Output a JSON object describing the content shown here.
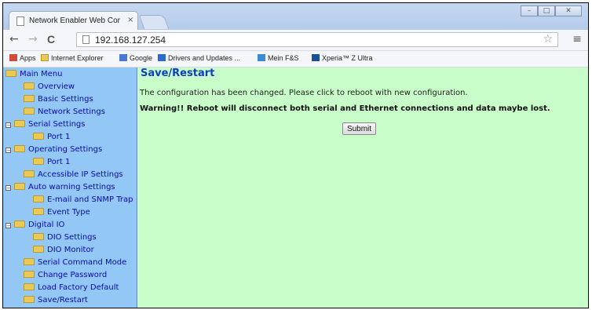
{
  "browser": {
    "tab_title": "Network Enabler Web Cor",
    "tab_close": "×",
    "url": "192.168.127.254",
    "nav": {
      "back": "←",
      "forward": "→",
      "reload": "C"
    },
    "window_buttons": {
      "minimize": "–",
      "maximize": "□",
      "close": "✕"
    },
    "star": "☆",
    "menu": "≡"
  },
  "bookmarks": [
    {
      "label": "Apps",
      "icon": "apps-grid-icon",
      "color": "#d24a3a"
    },
    {
      "label": "Internet Explorer",
      "icon": "folder-icon",
      "color": "#e8c95a"
    },
    {
      "label": "Google",
      "icon": "google-icon",
      "color": "#4a78d6"
    },
    {
      "label": "Drivers and Updates ...",
      "icon": "drivers-icon",
      "color": "#2a6bd0"
    },
    {
      "label": "Mein F&S",
      "icon": "fs-icon",
      "color": "#3a8ad8"
    },
    {
      "label": "Xperia™ Z Ultra",
      "icon": "xperia-icon",
      "color": "#1a4f9a"
    }
  ],
  "sidebar": {
    "items": [
      {
        "label": "Main Menu"
      },
      {
        "label": "Overview"
      },
      {
        "label": "Basic Settings"
      },
      {
        "label": "Network Settings"
      },
      {
        "label": "Serial Settings"
      },
      {
        "label": "Port 1"
      },
      {
        "label": "Operating Settings"
      },
      {
        "label": "Port 1"
      },
      {
        "label": "Accessible IP Settings"
      },
      {
        "label": "Auto warning Settings"
      },
      {
        "label": "E-mail and SNMP Trap"
      },
      {
        "label": "Event Type"
      },
      {
        "label": "Digital IO"
      },
      {
        "label": "DIO Settings"
      },
      {
        "label": "DIO Monitor"
      },
      {
        "label": "Serial Command Mode"
      },
      {
        "label": "Change Password"
      },
      {
        "label": "Load Factory Default"
      },
      {
        "label": "Save/Restart"
      }
    ],
    "expander_symbol": "−"
  },
  "main": {
    "title": "Save/Restart",
    "message": "The configuration has been changed. Please click to reboot with new configuration.",
    "warning": "Warning!! Reboot will disconnect both serial and Ethernet connections and data maybe lost.",
    "submit_label": "Submit"
  },
  "colors": {
    "sidebar_bg": "#93c7f5",
    "content_bg": "#c8fcc8",
    "title_color": "#0d3ec6",
    "link_color": "#0a0aa8"
  }
}
